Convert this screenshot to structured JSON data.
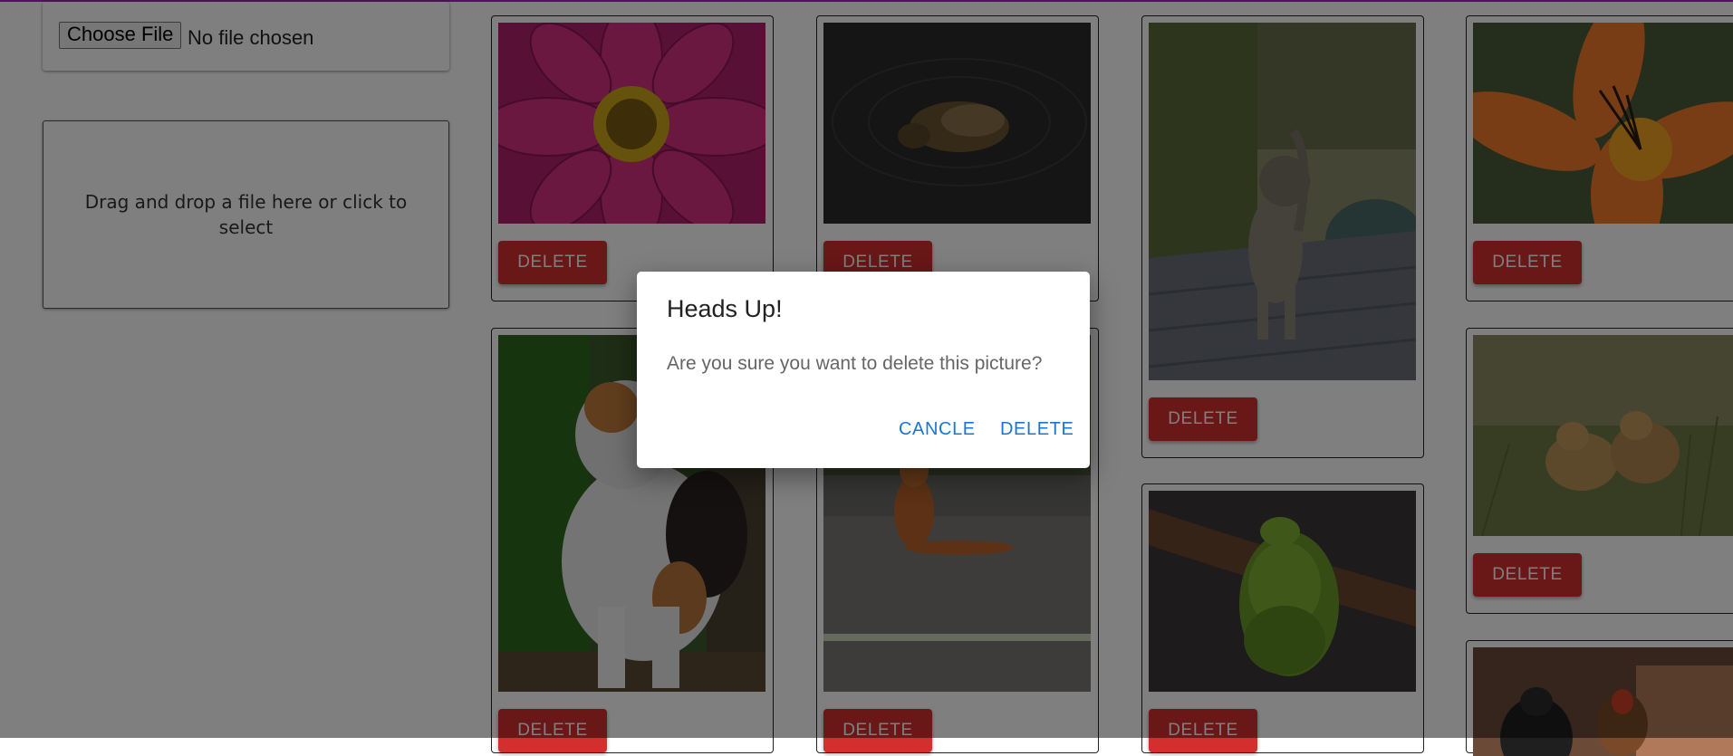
{
  "upload": {
    "choose_file_label": "Choose File",
    "no_file_text": "No file chosen",
    "dropzone_text": "Drag and drop a file here or click to select"
  },
  "gallery": {
    "delete_label": "DELETE",
    "photos": [
      {
        "subject": "pink cosmos flower"
      },
      {
        "subject": "duck swimming on dark water"
      },
      {
        "subject": "tabby cat on wooden deck"
      },
      {
        "subject": "orange lily flower"
      },
      {
        "subject": "calico cat in grass"
      },
      {
        "subject": "fox sitting on road"
      },
      {
        "subject": "green tree python on branch"
      },
      {
        "subject": "lion cubs in grass"
      },
      {
        "subject": "rooster and hen"
      }
    ]
  },
  "dialog": {
    "title": "Heads Up!",
    "message": "Are you sure you want to delete this picture?",
    "cancel_label": "CANCLE",
    "delete_label": "DELETE"
  },
  "colors": {
    "delete_button": "#d32f2f",
    "dialog_action": "#1976d2",
    "top_accent": "#9c27b0"
  }
}
